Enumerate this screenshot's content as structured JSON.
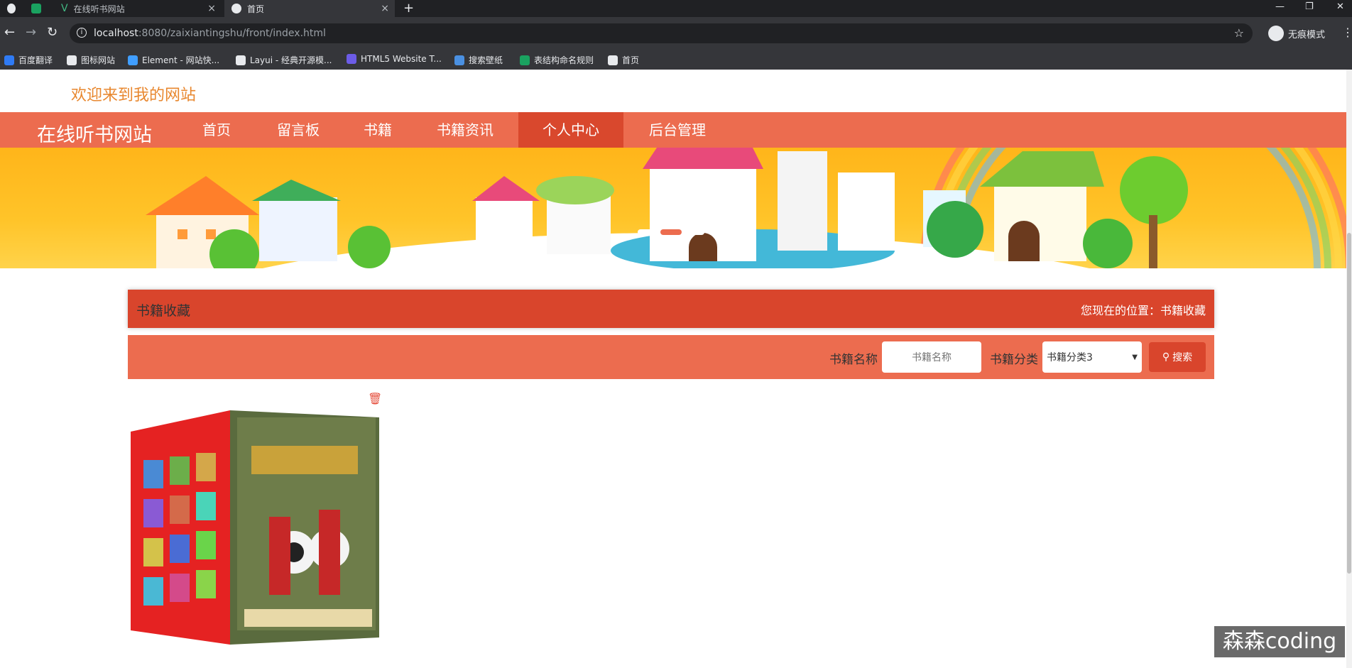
{
  "browser": {
    "tabs": [
      {
        "label": "",
        "icon": "globe-icon"
      },
      {
        "label": "",
        "icon": "green-app-icon"
      },
      {
        "label": "在线听书网站",
        "icon": "vue-icon"
      },
      {
        "label": "首页",
        "icon": "globe-icon"
      }
    ],
    "new_tab": "+",
    "url_host": "localhost",
    "url_rest": ":8080/zaixiantingshu/front/index.html",
    "incognito_label": "无痕模式",
    "bookmarks": [
      {
        "label": "百度翻译",
        "icon": "baidu-translate-icon",
        "color": "#2f7bf5"
      },
      {
        "label": "图标网站",
        "icon": "flag-icon",
        "color": "#e8eaed"
      },
      {
        "label": "Element - 网站快...",
        "icon": "element-icon",
        "color": "#409eff"
      },
      {
        "label": "Layui - 经典开源模...",
        "icon": "layui-icon",
        "color": "#e8eaed"
      },
      {
        "label": "HTML5 Website T...",
        "icon": "html5-template-icon",
        "color": "#6c5ce7"
      },
      {
        "label": "搜索壁纸",
        "icon": "wallpaper-icon",
        "color": "#4a90e2"
      },
      {
        "label": "表结构命名规则",
        "icon": "doc-icon",
        "color": "#1aa260"
      },
      {
        "label": "首页",
        "icon": "globe-icon",
        "color": "#e8eaed"
      }
    ]
  },
  "page": {
    "welcome": "欢迎来到我的网站",
    "brand": "在线听书网站",
    "nav": [
      "首页",
      "留言板",
      "书籍",
      "书籍资讯",
      "个人中心",
      "后台管理"
    ],
    "active_nav": "个人中心",
    "section_title": "书籍收藏",
    "location_label": "您现在的位置：",
    "location_value": "书籍收藏",
    "filter": {
      "name_label": "书籍名称",
      "name_placeholder": "书籍名称",
      "category_label": "书籍分类",
      "category_selected": "书籍分类3",
      "search_button": "搜索"
    },
    "watermark": "森森coding"
  },
  "colors": {
    "nav_bg": "#ec6c4f",
    "nav_active": "#d9482d",
    "crumb_bg": "#d9452c",
    "welcome": "#e8872e"
  }
}
